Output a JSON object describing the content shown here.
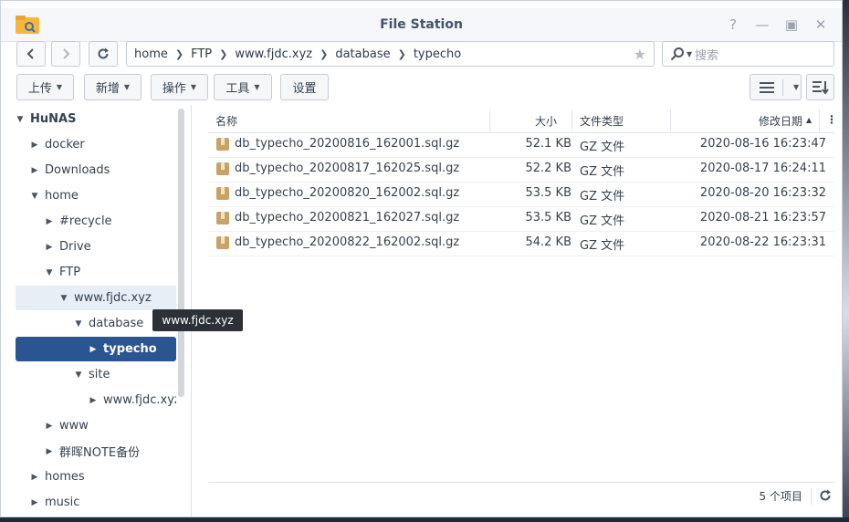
{
  "window": {
    "title": "File Station"
  },
  "nav": {
    "path": [
      "home",
      "FTP",
      "www.fjdc.xyz",
      "database",
      "typecho"
    ],
    "search_placeholder": "搜索"
  },
  "toolbar": {
    "upload": "上传",
    "create": "新增",
    "action": "操作",
    "tools": "工具",
    "settings": "设置"
  },
  "tree": {
    "root": "HuNAS",
    "items": [
      {
        "label": "docker"
      },
      {
        "label": "Downloads"
      },
      {
        "label": "home"
      },
      {
        "label": "#recycle"
      },
      {
        "label": "Drive"
      },
      {
        "label": "FTP"
      },
      {
        "label": "www.fjdc.xyz"
      },
      {
        "label": "database"
      },
      {
        "label": "typecho"
      },
      {
        "label": "site"
      },
      {
        "label": "www.fjdc.xyz"
      },
      {
        "label": "www"
      },
      {
        "label": "群晖NOTE备份"
      },
      {
        "label": "homes"
      },
      {
        "label": "music"
      }
    ],
    "tooltip": "www.fjdc.xyz"
  },
  "columns": {
    "name": "名称",
    "size": "大小",
    "type": "文件类型",
    "modified": "修改日期"
  },
  "files": [
    {
      "name": "db_typecho_20200816_162001.sql.gz",
      "size": "52.1 KB",
      "type": "GZ 文件",
      "modified": "2020-08-16 16:23:47"
    },
    {
      "name": "db_typecho_20200817_162025.sql.gz",
      "size": "52.2 KB",
      "type": "GZ 文件",
      "modified": "2020-08-17 16:24:11"
    },
    {
      "name": "db_typecho_20200820_162002.sql.gz",
      "size": "53.5 KB",
      "type": "GZ 文件",
      "modified": "2020-08-20 16:23:32"
    },
    {
      "name": "db_typecho_20200821_162027.sql.gz",
      "size": "53.5 KB",
      "type": "GZ 文件",
      "modified": "2020-08-21 16:23:57"
    },
    {
      "name": "db_typecho_20200822_162002.sql.gz",
      "size": "54.2 KB",
      "type": "GZ 文件",
      "modified": "2020-08-22 16:23:31"
    }
  ],
  "status": {
    "count": "5 个项目"
  },
  "colors": {
    "accent": "#2b5591",
    "folder": "#f5b73b"
  }
}
